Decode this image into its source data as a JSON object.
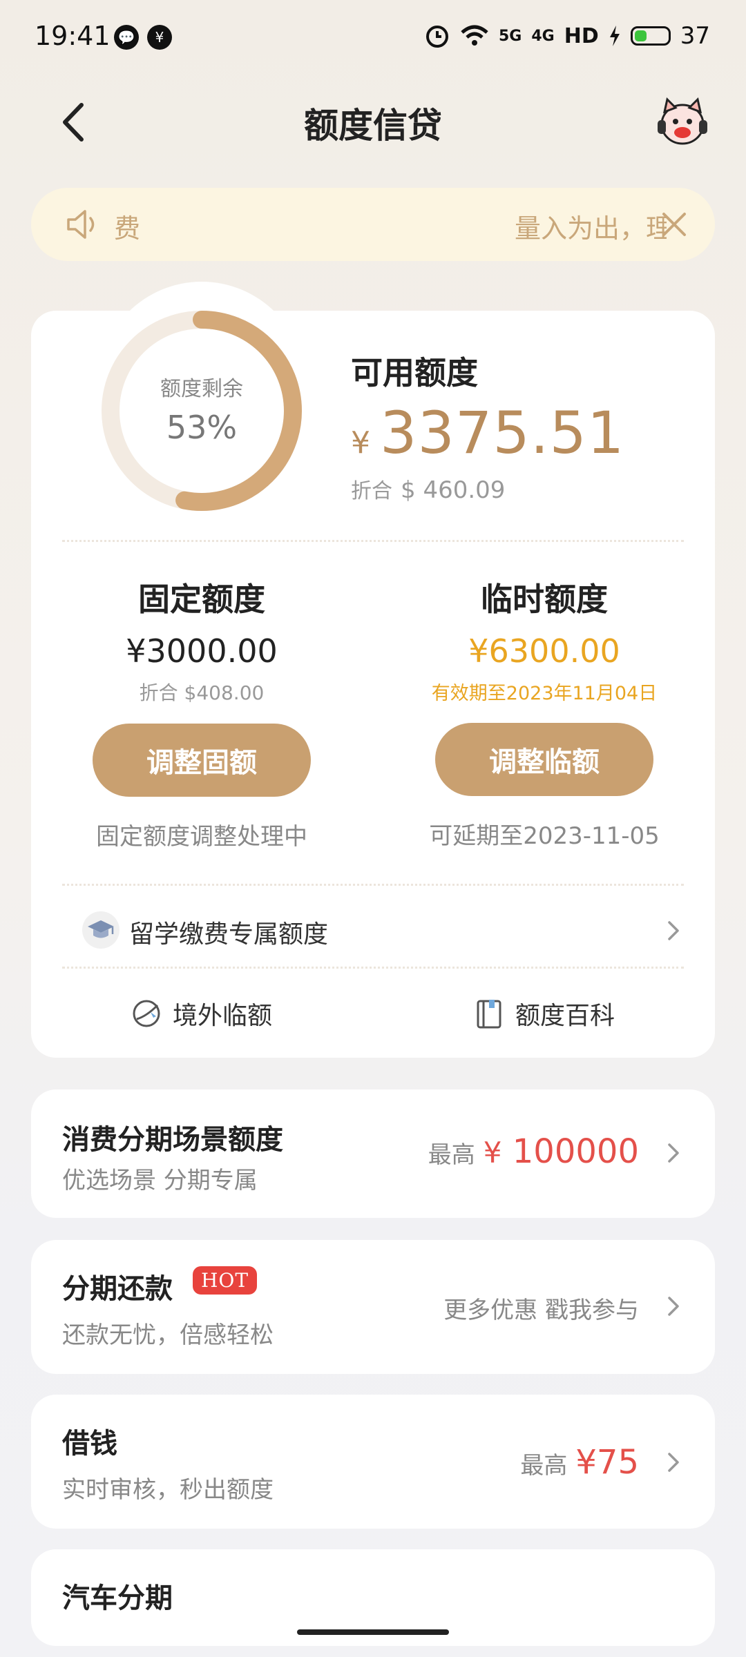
{
  "status_bar": {
    "time": "19:41",
    "signal_5g": "5G",
    "signal_4g": "4G",
    "hd": "HD",
    "battery_text": "37",
    "battery_level": 0.37
  },
  "header": {
    "title": "额度信贷"
  },
  "notice": {
    "lead_text": "费",
    "scroll_text": "量入为出，理"
  },
  "credit": {
    "ring_label": "额度剩余",
    "ring_percent_text": "53%",
    "ring_fraction": 0.53,
    "available_title": "可用额度",
    "available_yen": "¥",
    "available_amount": "3375.51",
    "converted_label": "折合",
    "converted_value": "$ 460.09"
  },
  "fixed": {
    "title": "固定额度",
    "amount": "¥3000.00",
    "converted": "折合 $408.00",
    "button": "调整固额",
    "status": "固定额度调整处理中"
  },
  "temporary": {
    "title": "临时额度",
    "amount": "¥6300.00",
    "validity": "有效期至2023年11月04日",
    "button": "调整临额",
    "status": "可延期至2023-11-05"
  },
  "study": {
    "label": "留学缴费专属额度"
  },
  "quick_links": {
    "overseas": "境外临额",
    "wiki": "额度百科"
  },
  "cards": {
    "installment_scene": {
      "title": "消费分期场景额度",
      "subtitle": "优选场景 分期专属",
      "prefix": "最高",
      "yen": "¥",
      "value": "100000"
    },
    "installment_repay": {
      "title": "分期还款",
      "badge": "HOT",
      "subtitle": "还款无忧，倍感轻松",
      "right_text": "更多优惠 戳我参与"
    },
    "borrow": {
      "title": "借钱",
      "subtitle": "实时审核，秒出额度",
      "prefix": "最高",
      "value": "¥75"
    },
    "car": {
      "title": "汽车分期"
    }
  },
  "colors": {
    "gold": "#c9a070",
    "amount_gold": "#b88c5c",
    "temp_amount": "#e9a521",
    "red": "#e4504a"
  }
}
